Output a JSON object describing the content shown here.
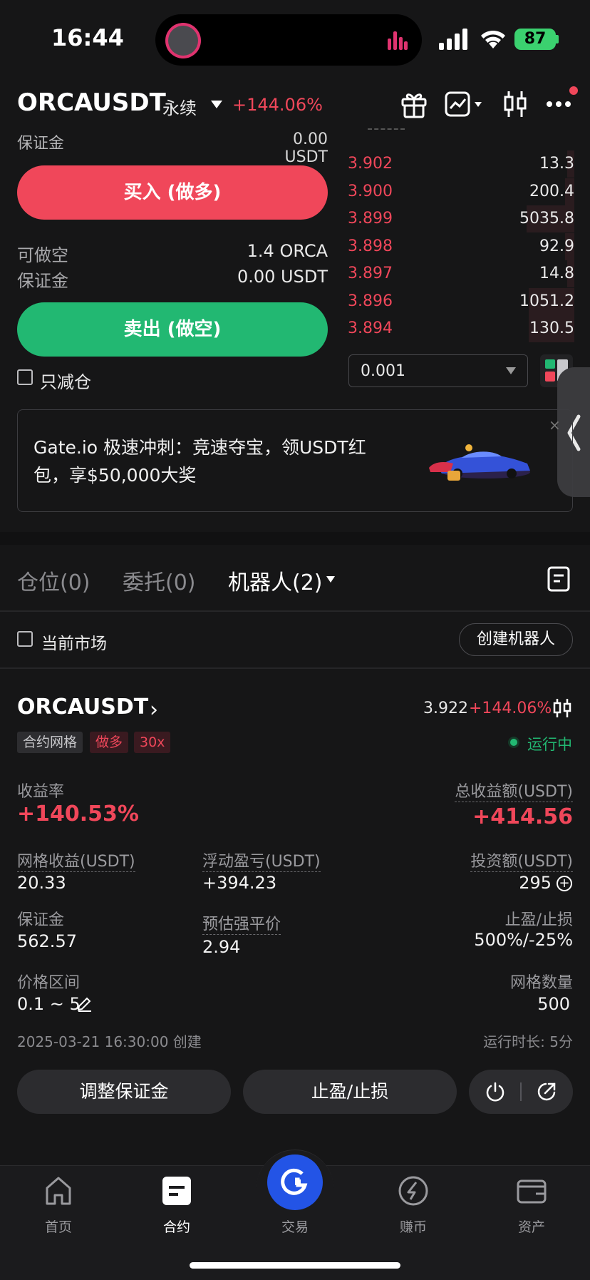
{
  "status_bar": {
    "time": "16:44",
    "battery": "87"
  },
  "header": {
    "pair": "ORCAUSDT",
    "contract_type": "永续",
    "change": "+144.06%",
    "icons": [
      "gift-icon",
      "chart-icon",
      "candlestick-icon",
      "more-icon"
    ]
  },
  "trade_panel": {
    "cut_label": "保证金",
    "cut_value": "0.00 USDT",
    "buy_label": "买入 (做多)",
    "short_avail_label": "可做空",
    "short_avail_value": "1.4 ORCA",
    "margin_label": "保证金",
    "margin_value": "0.00 USDT",
    "sell_label": "卖出 (做空)",
    "reduce_only_label": "只减仓"
  },
  "order_book": {
    "asks": [
      {
        "price": "3.902",
        "qty": "13.3",
        "depth": 0.03
      },
      {
        "price": "3.900",
        "qty": "200.4",
        "depth": 0.04
      },
      {
        "price": "3.899",
        "qty": "5035.8",
        "depth": 0.21
      },
      {
        "price": "3.898",
        "qty": "92.9",
        "depth": 0.04
      },
      {
        "price": "3.897",
        "qty": "14.8",
        "depth": 0.03
      },
      {
        "price": "3.896",
        "qty": "1051.2",
        "depth": 0.2
      },
      {
        "price": "3.894",
        "qty": "130.5",
        "depth": 0.2
      }
    ],
    "precision": "0.001"
  },
  "banner": {
    "text": "Gate.io 极速冲刺：竞速夺宝，领USDT红包，享$50,000大奖",
    "close": "×"
  },
  "tabs": {
    "positions": "仓位(0)",
    "orders": "委托(0)",
    "bots": "机器人(2)"
  },
  "filter": {
    "current_market": "当前市场",
    "create_bot": "创建机器人"
  },
  "bot": {
    "pair": "ORCAUSDT",
    "price": "3.922",
    "change": "+144.06%",
    "tag_type": "合约网格",
    "tag_side": "做多",
    "tag_leverage": "30x",
    "status": "运行中",
    "roi_label": "收益率",
    "roi_value": "+140.53%",
    "total_profit_label": "总收益额(USDT)",
    "total_profit_value": "+414.56",
    "grid_profit_label": "网格收益(USDT)",
    "grid_profit_value": "20.33",
    "floating_pnl_label": "浮动盈亏(USDT)",
    "floating_pnl_value": "+394.23",
    "investment_label": "投资额(USDT)",
    "investment_value": "295",
    "margin_label": "保证金",
    "margin_value": "562.57",
    "liq_price_label": "预估强平价",
    "liq_price_value": "2.94",
    "tp_sl_label": "止盈/止损",
    "tp_sl_value": "500%/-25%",
    "price_range_label": "价格区间",
    "price_range_value": "0.1 ~ 5",
    "grid_count_label": "网格数量",
    "grid_count_value": "500",
    "created": "2025-03-21 16:30:00 创建",
    "runtime": "运行时长: 5分",
    "adjust_margin_button": "调整保证金",
    "tp_sl_button": "止盈/止损"
  },
  "bottom_nav": {
    "home": "首页",
    "futures": "合约",
    "trade": "交易",
    "earn": "赚币",
    "assets": "资产"
  },
  "colors": {
    "red": "#f0475a",
    "green": "#22b872",
    "blue": "#2354e6",
    "background": "#161617"
  }
}
